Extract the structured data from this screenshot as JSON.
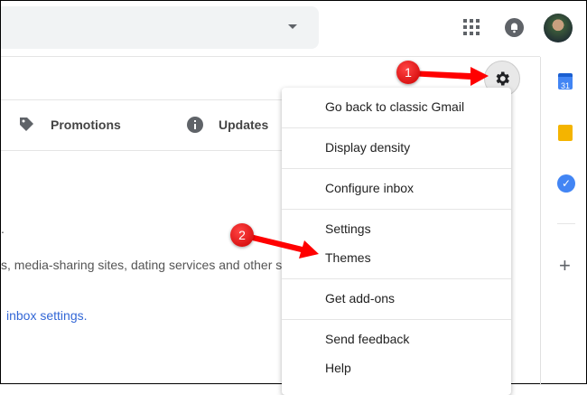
{
  "tabs": {
    "promotions": "Promotions",
    "updates": "Updates"
  },
  "body": {
    "line1": ".",
    "line2": "s, media-sharing sites, dating services and other so",
    "link": "inbox settings."
  },
  "menu": {
    "items": [
      "Go back to classic Gmail",
      "Display density",
      "Configure inbox",
      "Settings",
      "Themes",
      "Get add-ons",
      "Send feedback",
      "Help"
    ]
  },
  "side": {
    "calendar_day": "31"
  },
  "annotations": {
    "one": "1",
    "two": "2"
  },
  "colors": {
    "accent": "#ff0000"
  }
}
